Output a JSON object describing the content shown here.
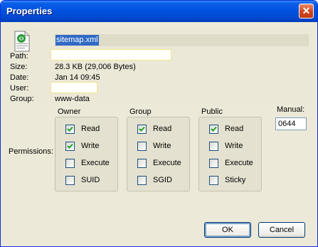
{
  "window": {
    "title": "Properties",
    "close_glyph": "✕"
  },
  "file": {
    "name": "sitemap.xml",
    "icon": "xml-file-icon",
    "labels": {
      "path": "Path:",
      "size": "Size:",
      "date": "Date:",
      "user": "User:",
      "group": "Group:"
    },
    "values": {
      "path": "",
      "size": "28.3 KB  (29,006 Bytes)",
      "date": "Jan 14 09:45",
      "user": "",
      "group": "www-data"
    }
  },
  "permissions": {
    "label": "Permissions:",
    "owner": {
      "title": "Owner",
      "items": [
        {
          "label": "Read",
          "checked": true
        },
        {
          "label": "Write",
          "checked": true
        },
        {
          "label": "Execute",
          "checked": false
        },
        {
          "label": "SUID",
          "checked": false
        }
      ]
    },
    "group": {
      "title": "Group",
      "items": [
        {
          "label": "Read",
          "checked": true
        },
        {
          "label": "Write",
          "checked": false
        },
        {
          "label": "Execute",
          "checked": false
        },
        {
          "label": "SGID",
          "checked": false
        }
      ]
    },
    "public": {
      "title": "Public",
      "items": [
        {
          "label": "Read",
          "checked": true
        },
        {
          "label": "Write",
          "checked": false
        },
        {
          "label": "Execute",
          "checked": false
        },
        {
          "label": "Sticky",
          "checked": false
        }
      ]
    }
  },
  "manual": {
    "label": "Manual:",
    "value": "0644"
  },
  "buttons": {
    "ok": "OK",
    "cancel": "Cancel"
  },
  "colors": {
    "title_bar": "#0052e0",
    "selection": "#316ac5",
    "dialog_bg": "#ece9d8",
    "check": "#21a121"
  }
}
